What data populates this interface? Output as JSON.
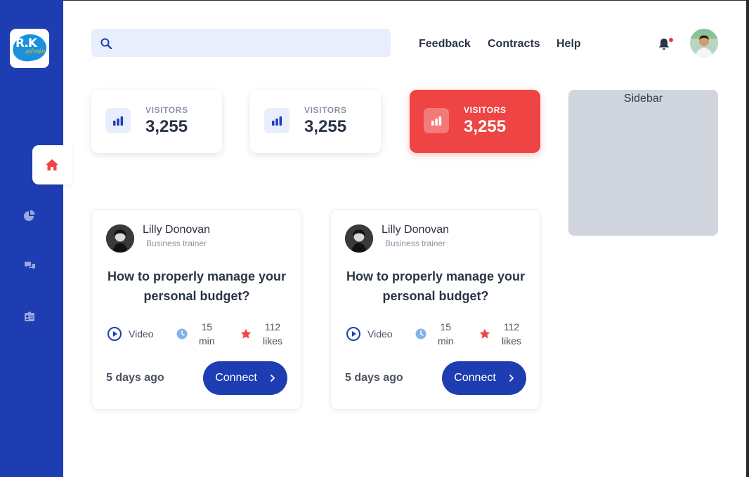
{
  "brand": {
    "logo_text": "R.K",
    "logo_sub": "admin"
  },
  "nav": {
    "items": [
      {
        "icon": "home-icon",
        "active": true
      },
      {
        "icon": "pie-chart-icon",
        "active": false
      },
      {
        "icon": "chat-icon",
        "active": false
      },
      {
        "icon": "id-card-icon",
        "active": false
      }
    ]
  },
  "header": {
    "search": {
      "placeholder": "",
      "value": ""
    },
    "links": [
      "Feedback",
      "Contracts",
      "Help"
    ],
    "notifications": {
      "has_unread": true
    }
  },
  "stats": [
    {
      "label": "VISITORS",
      "value": "3,255",
      "active": false
    },
    {
      "label": "VISITORS",
      "value": "3,255",
      "active": false
    },
    {
      "label": "VISITORS",
      "value": "3,255",
      "active": true
    }
  ],
  "sidebar": {
    "title": "Sidebar"
  },
  "cards": [
    {
      "author": "Lilly Donovan",
      "role": "Business trainer",
      "title": "How to properly manage your personal budget?",
      "type": "Video",
      "duration_value": "15",
      "duration_unit": "min",
      "likes_value": "112",
      "likes_unit": "likes",
      "posted": "5 days ago",
      "button": "Connect"
    },
    {
      "author": "Lilly Donovan",
      "role": "Business trainer",
      "title": "How to properly manage your personal budget?",
      "type": "Video",
      "duration_value": "15",
      "duration_unit": "min",
      "likes_value": "112",
      "likes_unit": "likes",
      "posted": "5 days ago",
      "button": "Connect"
    }
  ],
  "colors": {
    "primary": "#1e3db3",
    "accent_red": "#ef4444",
    "search_bg": "#e9eefc",
    "sidebar_bg": "#d1d5de",
    "clock_blue": "#7fb2ee"
  }
}
